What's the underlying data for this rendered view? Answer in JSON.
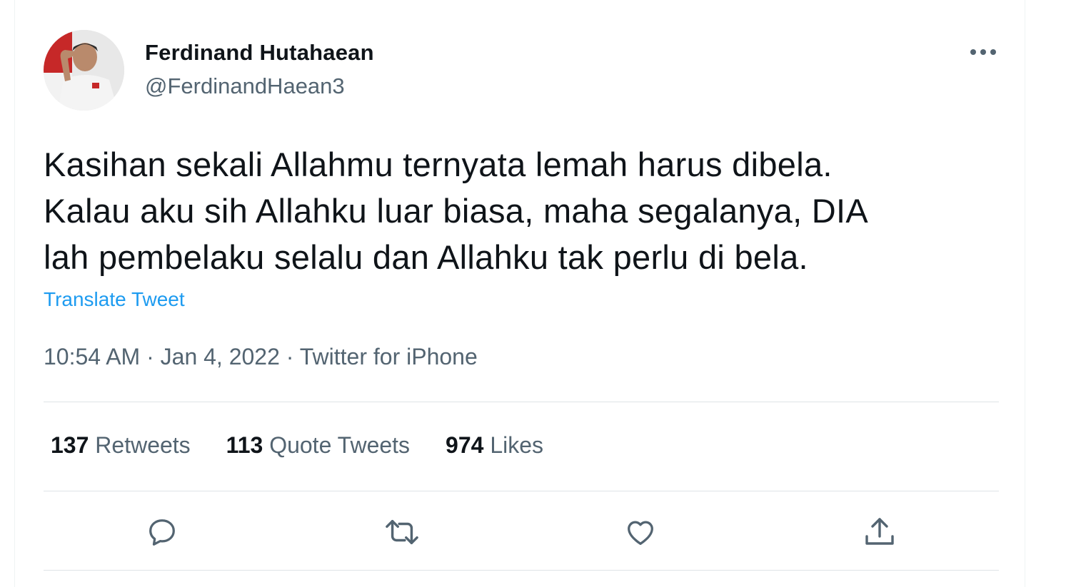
{
  "user": {
    "display_name": "Ferdinand Hutahaean",
    "handle": "@FerdinandHaean3",
    "avatar_icon": "profile-photo-saluting-man"
  },
  "menu": {
    "more_icon": "more-horizontal-icon"
  },
  "tweet": {
    "text": "Kasihan sekali Allahmu ternyata lemah harus dibela.\nKalau aku sih Allahku luar biasa, maha segalanya, DIA\nlah pembelaku selalu dan Allahku tak perlu di bela.",
    "translate_label": "Translate Tweet",
    "time": "10:54 AM",
    "separator": " · ",
    "date": "Jan 4, 2022",
    "source": "Twitter for iPhone"
  },
  "stats": {
    "retweets_count": "137",
    "retweets_label": " Retweets",
    "quotes_count": "113",
    "quotes_label": " Quote Tweets",
    "likes_count": "974",
    "likes_label": " Likes"
  },
  "actions": {
    "reply_icon": "reply-icon",
    "retweet_icon": "retweet-icon",
    "like_icon": "like-icon",
    "share_icon": "share-icon"
  },
  "colors": {
    "text_primary": "#0f1419",
    "text_secondary": "#536471",
    "link": "#1d9bf0",
    "divider": "#dfe4e7"
  }
}
